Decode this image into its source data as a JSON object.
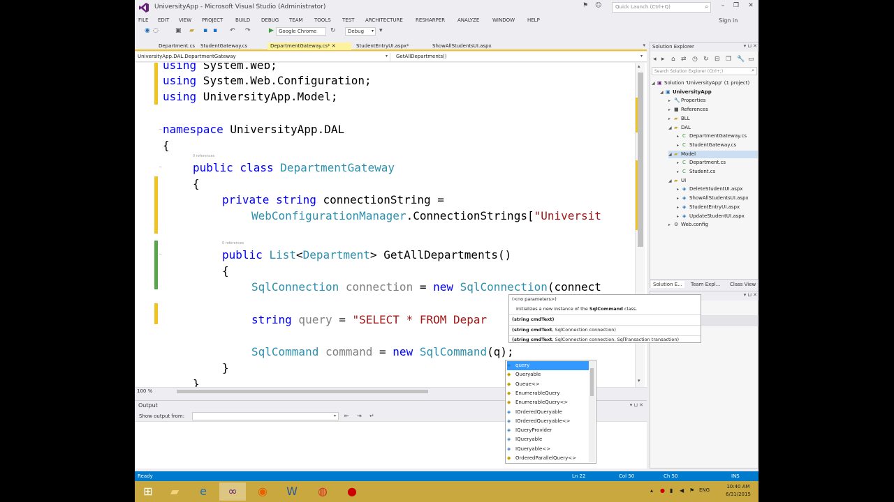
{
  "window": {
    "title": "UniversityApp - Microsoft Visual Studio (Administrator)",
    "quick_launch_placeholder": "Quick Launch (Ctrl+Q)",
    "sign_in": "Sign in"
  },
  "menu": [
    "FILE",
    "EDIT",
    "VIEW",
    "PROJECT",
    "BUILD",
    "DEBUG",
    "TEAM",
    "TOOLS",
    "TEST",
    "ARCHITECTURE",
    "RESHARPER",
    "ANALYZE",
    "WINDOW",
    "HELP"
  ],
  "toolbar": {
    "browser": "Google Chrome",
    "config": "Debug"
  },
  "doc_tabs": [
    "Department.cs",
    "StudentGateway.cs",
    "DepartmentGateway.cs*",
    "StudentEntryUI.aspx*",
    "ShowAllStudentsUI.aspx"
  ],
  "nav": {
    "left": "UniversityApp.DAL.DepartmentGateway",
    "right": "GetAllDepartments()"
  },
  "code": {
    "l1_kw": "using",
    "l1_rest": " System.Web;",
    "l2_kw": "using",
    "l2_rest": " System.Web.Configuration;",
    "l3_kw": "using",
    "l3_rest": " UniversityApp.Model;",
    "l4_kw": "namespace",
    "l4_rest": " UniversityApp.DAL",
    "l5": "{",
    "ref1": "0 references",
    "l6_kw": "public class ",
    "l6_ty": "DepartmentGateway",
    "l7": "{",
    "l8_kw": "private string ",
    "l8_rest": "connectionString =",
    "l9_ty": "WebConfigurationManager",
    "l9_rest": ".ConnectionStrings[",
    "l9_st": "\"Universit",
    "ref2": "0 references",
    "l10_kw": "public ",
    "l10_ty1": "List",
    "l10_a": "<",
    "l10_ty2": "Department",
    "l10_b": "> GetAllDepartments()",
    "l11": "{",
    "l12_ty1": "SqlConnection",
    "l12_gr": " connection",
    "l12_a": " = ",
    "l12_kw": "new ",
    "l12_ty2": "SqlConnection",
    "l12_b": "(connect",
    "l13_kw": "string",
    "l13_gr": " query",
    "l13_a": " = ",
    "l13_st": "\"SELECT * FROM Depar",
    "l14_ty1": "SqlCommand",
    "l14_gr": " command",
    "l14_a": " = ",
    "l14_kw": "new ",
    "l14_ty2": "SqlCommand",
    "l14_b": "(q);",
    "l15": "}",
    "l16": "}"
  },
  "editor": {
    "zoom": "100 %"
  },
  "param_info": {
    "line1": "(<no parameters>)",
    "line2_pre": "Initializes a new instance of the ",
    "line2_bold": "SqlCommand",
    "line2_post": " class.",
    "line3": "(string cmdText)",
    "line4_bold": "(string cmdText",
    "line4_post": ", SqlConnection connection)",
    "line5_bold": "(string cmdText",
    "line5_post": ", SqlConnection connection, SqlTransaction transaction)"
  },
  "completion": [
    "query",
    "Queryable",
    "Queue<>",
    "EnumerableQuery",
    "EnumerableQuery<>",
    "IOrderedQueryable",
    "IOrderedQueryable<>",
    "IQueryProvider",
    "IQueryable",
    "IQueryable<>",
    "OrderedParallelQuery<>"
  ],
  "output": {
    "title": "Output",
    "show_from": "Show output from:"
  },
  "solution_explorer": {
    "title": "Solution Explorer",
    "search_placeholder": "Search Solution Explorer (Ctrl+;)",
    "items": [
      {
        "label": "Solution 'UniversityApp' (1 project)",
        "indent": 0,
        "icon": "solution-icon"
      },
      {
        "label": "UniversityApp",
        "indent": 1,
        "icon": "project-icon",
        "bold": true
      },
      {
        "label": "Properties",
        "indent": 2,
        "icon": "wrench-icon"
      },
      {
        "label": "References",
        "indent": 2,
        "icon": "references-icon"
      },
      {
        "label": "BLL",
        "indent": 2,
        "icon": "folder-icon"
      },
      {
        "label": "DAL",
        "indent": 2,
        "icon": "folder-icon"
      },
      {
        "label": "DepartmentGateway.cs",
        "indent": 3,
        "icon": "csharp-file-icon"
      },
      {
        "label": "StudentGateway.cs",
        "indent": 3,
        "icon": "csharp-file-icon"
      },
      {
        "label": "Model",
        "indent": 2,
        "icon": "folder-icon",
        "selected": true
      },
      {
        "label": "Department.cs",
        "indent": 3,
        "icon": "csharp-file-icon"
      },
      {
        "label": "Student.cs",
        "indent": 3,
        "icon": "csharp-file-icon"
      },
      {
        "label": "UI",
        "indent": 2,
        "icon": "folder-icon"
      },
      {
        "label": "DeleteStudentUI.aspx",
        "indent": 3,
        "icon": "aspx-file-icon"
      },
      {
        "label": "ShowAllStudentsUI.aspx",
        "indent": 3,
        "icon": "aspx-file-icon"
      },
      {
        "label": "StudentEntryUI.aspx",
        "indent": 3,
        "icon": "aspx-file-icon"
      },
      {
        "label": "UpdateStudentUI.aspx",
        "indent": 3,
        "icon": "aspx-file-icon"
      },
      {
        "label": "Web.config",
        "indent": 2,
        "icon": "config-file-icon"
      }
    ],
    "tabs": [
      "Solution E...",
      "Team Expl...",
      "Class View"
    ]
  },
  "status": {
    "ready": "Ready",
    "ln": "Ln 22",
    "col": "Col 50",
    "ch": "Ch 50",
    "ins": "INS"
  },
  "taskbar": {
    "lang": "ENG",
    "time": "10:40 AM",
    "date": "6/31/2015"
  },
  "colors": {
    "keyword": "#0000ff",
    "type": "#2b91af",
    "string": "#a31515",
    "status_bar": "#007acc",
    "taskbar": "#c9a83f"
  }
}
